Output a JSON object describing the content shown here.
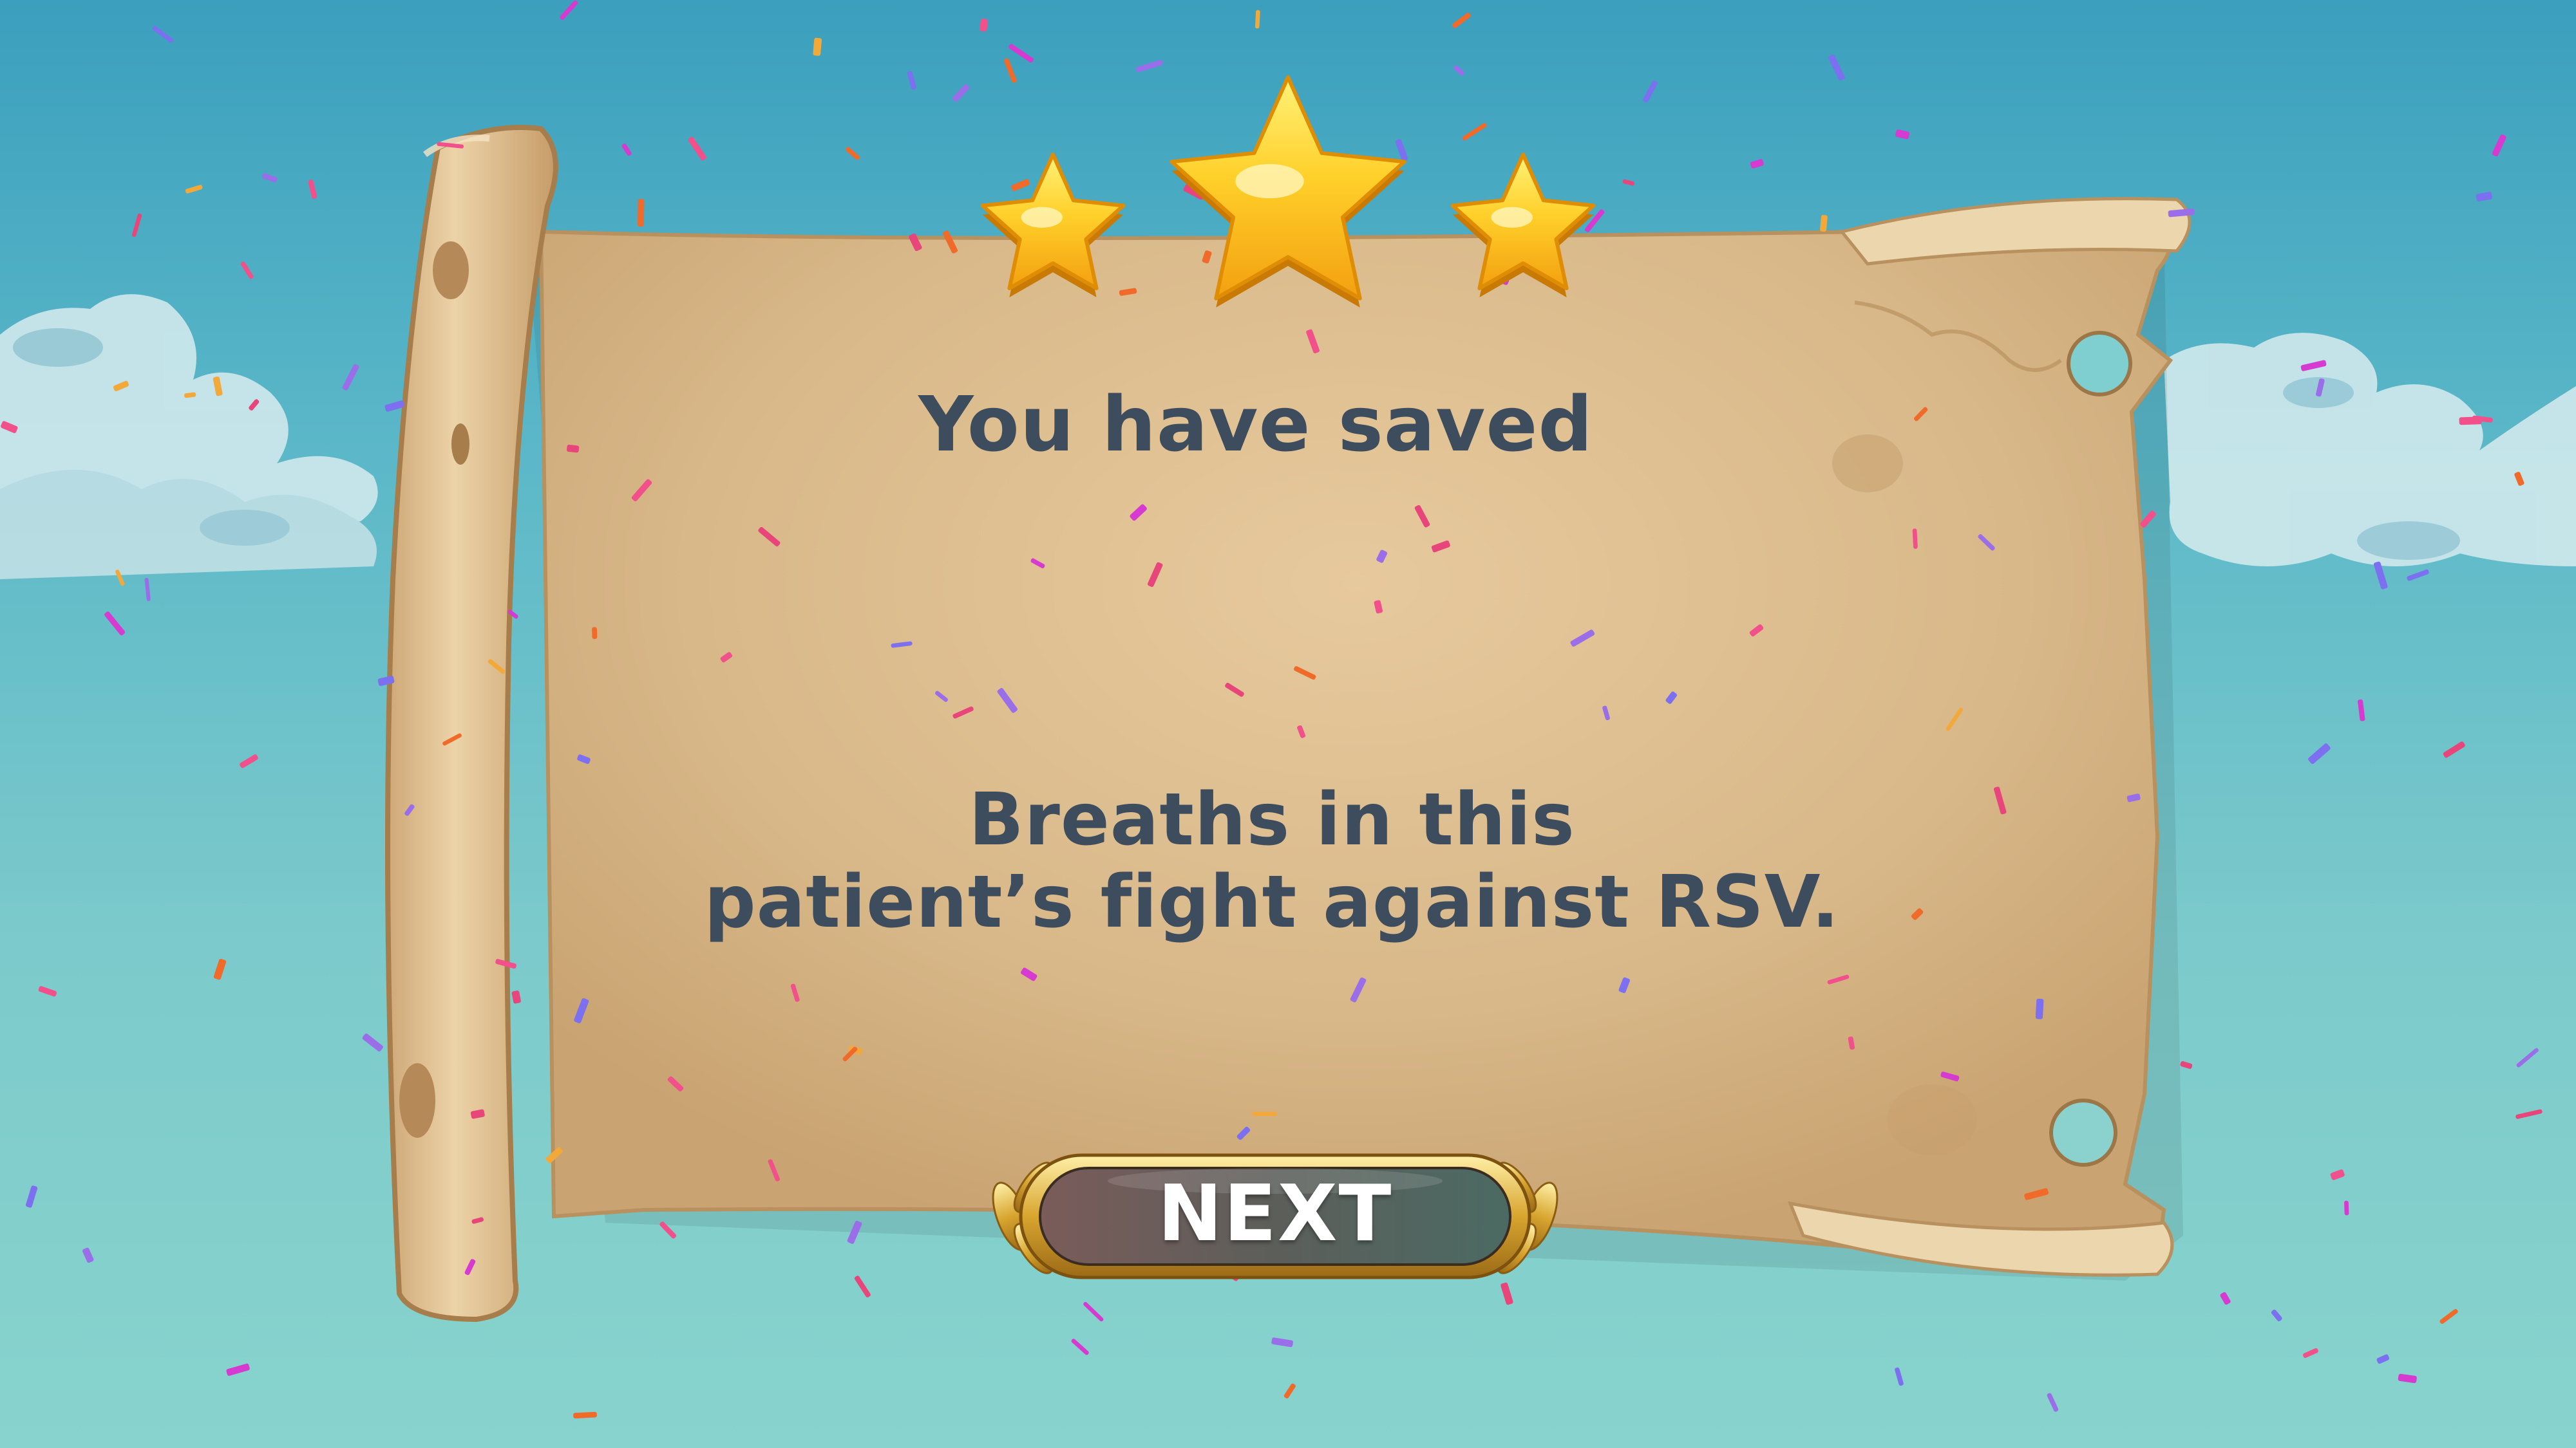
{
  "screen": {
    "title": "You have saved",
    "message_line1": "Breaths in this",
    "message_line2": "patient’s fight against RSV.",
    "next_button_label": "NEXT"
  },
  "rating": {
    "stars_earned": 3,
    "stars_total": 3
  },
  "icons": {
    "star": "star-icon",
    "laurel": "laurel-icon"
  },
  "colors": {
    "sky_top": "#3b9fbd",
    "sky_bottom": "#88d3cd",
    "parchment": "#d8b789",
    "text": "#3e4d5e",
    "star_gold": "#f7b51e",
    "button_gold": "#d8a52f"
  }
}
